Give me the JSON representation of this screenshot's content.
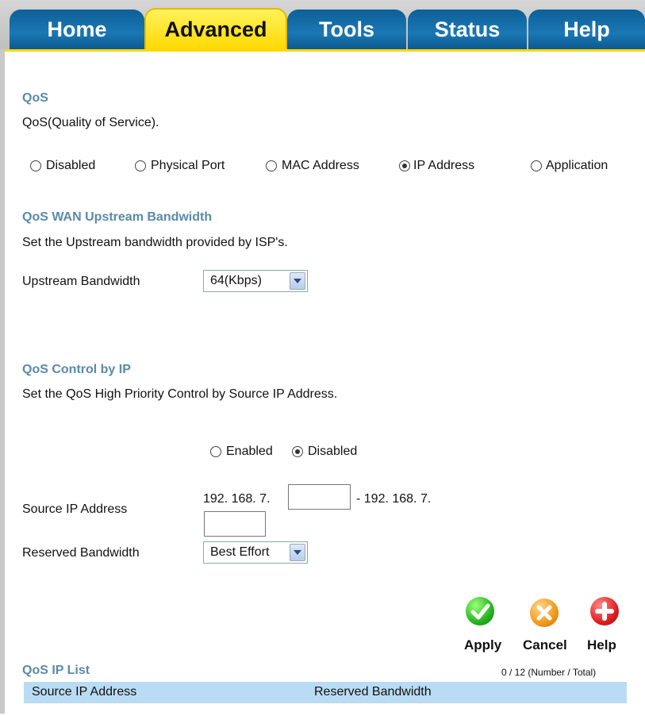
{
  "tabs": [
    {
      "label": "Home"
    },
    {
      "label": "Advanced"
    },
    {
      "label": "Tools"
    },
    {
      "label": "Status"
    },
    {
      "label": "Help"
    }
  ],
  "qos": {
    "heading": "QoS",
    "description": "QoS(Quality of Service).",
    "options": [
      "Disabled",
      "Physical Port",
      "MAC Address",
      "IP Address",
      "Application"
    ],
    "selected": "IP Address"
  },
  "upstream": {
    "heading": "QoS WAN Upstream Bandwidth",
    "description": "Set the Upstream bandwidth provided by ISP's.",
    "label": "Upstream Bandwidth",
    "value": "64(Kbps)"
  },
  "control": {
    "heading": "QoS Control by IP",
    "description": "Set the QoS High Priority Control by Source IP Address.",
    "enabled_label": "Enabled",
    "disabled_label": "Disabled",
    "selected": "Disabled",
    "source_label": "Source IP Address",
    "ip_prefix": "192. 168. 7.",
    "ip_sep": "- 192. 168. 7.",
    "start_value": "",
    "end_value": "",
    "reserved_label": "Reserved Bandwidth",
    "reserved_value": "Best Effort"
  },
  "buttons": {
    "apply": "Apply",
    "cancel": "Cancel",
    "help": "Help"
  },
  "list": {
    "heading": "QoS IP List",
    "count": "0 / 12 (Number / Total)",
    "col1": "Source IP Address",
    "col2": "Reserved Bandwidth"
  }
}
